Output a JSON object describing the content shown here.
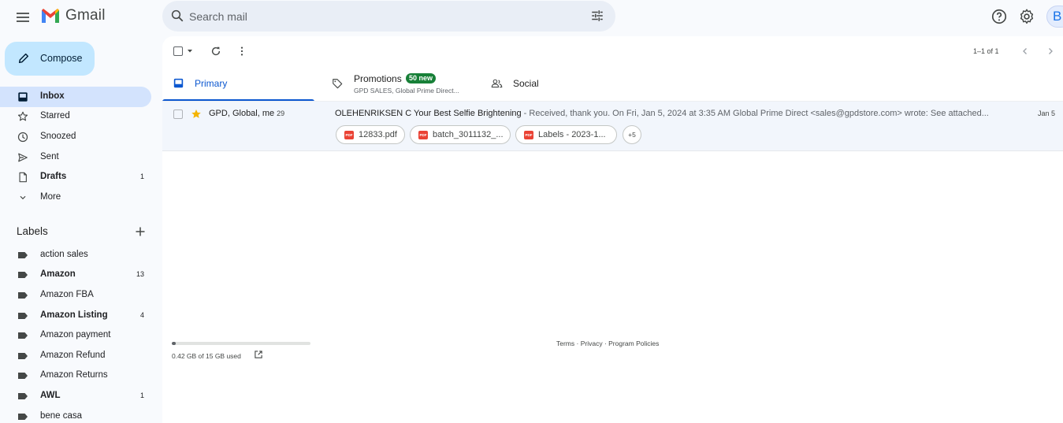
{
  "app": {
    "name": "Gmail",
    "account_initial": "B"
  },
  "search": {
    "placeholder": "Search mail"
  },
  "compose": {
    "label": "Compose"
  },
  "nav": [
    {
      "label": "Inbox",
      "count": "",
      "icon": "inbox-icon",
      "active": true,
      "bold": true
    },
    {
      "label": "Starred",
      "count": "",
      "icon": "star-icon",
      "active": false,
      "bold": false
    },
    {
      "label": "Snoozed",
      "count": "",
      "icon": "clock-icon",
      "active": false,
      "bold": false
    },
    {
      "label": "Sent",
      "count": "",
      "icon": "send-icon",
      "active": false,
      "bold": false
    },
    {
      "label": "Drafts",
      "count": "1",
      "icon": "draft-icon",
      "active": false,
      "bold": true
    },
    {
      "label": "More",
      "count": "",
      "icon": "chevron-down-icon",
      "active": false,
      "bold": false
    }
  ],
  "labels": {
    "title": "Labels",
    "items": [
      {
        "label": "action sales",
        "count": "",
        "bold": false
      },
      {
        "label": "Amazon",
        "count": "13",
        "bold": true
      },
      {
        "label": "Amazon FBA",
        "count": "",
        "bold": false
      },
      {
        "label": "Amazon Listing",
        "count": "4",
        "bold": true
      },
      {
        "label": "Amazon payment",
        "count": "",
        "bold": false
      },
      {
        "label": "Amazon Refund",
        "count": "",
        "bold": false
      },
      {
        "label": "Amazon Returns",
        "count": "",
        "bold": false
      },
      {
        "label": "AWL",
        "count": "1",
        "bold": true
      },
      {
        "label": "bene casa",
        "count": "",
        "bold": false
      }
    ]
  },
  "toolbar": {
    "pager": "1–1 of 1"
  },
  "tabs": {
    "primary": {
      "label": "Primary"
    },
    "promotions": {
      "label": "Promotions",
      "badge": "50 new",
      "sub": "GPD SALES, Global Prime Direct..."
    },
    "social": {
      "label": "Social"
    }
  },
  "emails": [
    {
      "sender": "GPD, Global, me",
      "thread_count": "29",
      "subject": "OLEHENRIKSEN C Your Best Selfie Brightening",
      "snippet": " - Received, thank you. On Fri, Jan 5, 2024 at 3:35 AM Global Prime Direct <sales@gpdstore.com> wrote: See attached...",
      "date": "Jan 5",
      "starred": true,
      "attachments": [
        "12833.pdf",
        "batch_3011132_...",
        "Labels - 2023-1..."
      ],
      "more_attachments": "+5"
    }
  ],
  "storage": {
    "text": "0.42 GB of 15 GB used",
    "used_fraction": 0.028
  },
  "footer": {
    "terms": "Terms",
    "privacy": "Privacy",
    "policies": "Program Policies",
    "sep": " · "
  },
  "colors": {
    "accent": "#0b57d0",
    "compose_bg": "#c2e7ff",
    "active_nav": "#d3e3fd",
    "badge_green": "#188038",
    "pdf_red": "#ea4335",
    "star": "#f4b400"
  }
}
